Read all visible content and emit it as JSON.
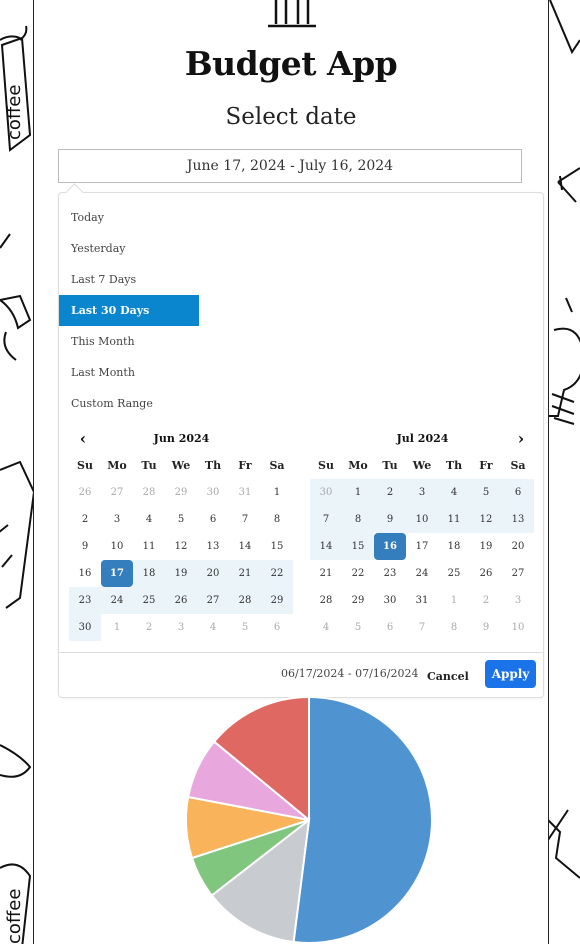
{
  "app": {
    "title": "Budget App",
    "subtitle": "Select date"
  },
  "date_input": {
    "value": "June 17, 2024 - July 16, 2024"
  },
  "ranges": [
    {
      "label": "Today",
      "active": false
    },
    {
      "label": "Yesterday",
      "active": false
    },
    {
      "label": "Last 7 Days",
      "active": false
    },
    {
      "label": "Last 30 Days",
      "active": true
    },
    {
      "label": "This Month",
      "active": false
    },
    {
      "label": "Last Month",
      "active": false
    },
    {
      "label": "Custom Range",
      "active": false
    }
  ],
  "weekdays": [
    "Su",
    "Mo",
    "Tu",
    "We",
    "Th",
    "Fr",
    "Sa"
  ],
  "calendars": [
    {
      "month": "Jun 2024",
      "days": [
        [
          "26",
          "off"
        ],
        [
          "27",
          "off"
        ],
        [
          "28",
          "off"
        ],
        [
          "29",
          "off"
        ],
        [
          "30",
          "off"
        ],
        [
          "31",
          "off"
        ],
        [
          "1",
          ""
        ],
        [
          "2",
          ""
        ],
        [
          "3",
          ""
        ],
        [
          "4",
          ""
        ],
        [
          "5",
          ""
        ],
        [
          "6",
          ""
        ],
        [
          "7",
          ""
        ],
        [
          "8",
          ""
        ],
        [
          "9",
          ""
        ],
        [
          "10",
          ""
        ],
        [
          "11",
          ""
        ],
        [
          "12",
          ""
        ],
        [
          "13",
          ""
        ],
        [
          "14",
          ""
        ],
        [
          "15",
          ""
        ],
        [
          "16",
          ""
        ],
        [
          "17",
          "sel"
        ],
        [
          "18",
          "in"
        ],
        [
          "19",
          "in"
        ],
        [
          "20",
          "in"
        ],
        [
          "21",
          "in"
        ],
        [
          "22",
          "in"
        ],
        [
          "23",
          "in"
        ],
        [
          "24",
          "in"
        ],
        [
          "25",
          "in"
        ],
        [
          "26",
          "in"
        ],
        [
          "27",
          "in"
        ],
        [
          "28",
          "in"
        ],
        [
          "29",
          "in"
        ],
        [
          "30",
          "in"
        ],
        [
          "1",
          "off"
        ],
        [
          "2",
          "off"
        ],
        [
          "3",
          "off"
        ],
        [
          "4",
          "off"
        ],
        [
          "5",
          "off"
        ],
        [
          "6",
          "off"
        ]
      ]
    },
    {
      "month": "Jul 2024",
      "days": [
        [
          "30",
          "off-in"
        ],
        [
          "1",
          "in"
        ],
        [
          "2",
          "in"
        ],
        [
          "3",
          "in"
        ],
        [
          "4",
          "in"
        ],
        [
          "5",
          "in"
        ],
        [
          "6",
          "in"
        ],
        [
          "7",
          "in"
        ],
        [
          "8",
          "in"
        ],
        [
          "9",
          "in"
        ],
        [
          "10",
          "in"
        ],
        [
          "11",
          "in"
        ],
        [
          "12",
          "in"
        ],
        [
          "13",
          "in"
        ],
        [
          "14",
          "in"
        ],
        [
          "15",
          "in"
        ],
        [
          "16",
          "sel"
        ],
        [
          "17",
          ""
        ],
        [
          "18",
          ""
        ],
        [
          "19",
          ""
        ],
        [
          "20",
          ""
        ],
        [
          "21",
          ""
        ],
        [
          "22",
          ""
        ],
        [
          "23",
          ""
        ],
        [
          "24",
          ""
        ],
        [
          "25",
          ""
        ],
        [
          "26",
          ""
        ],
        [
          "27",
          ""
        ],
        [
          "28",
          ""
        ],
        [
          "29",
          ""
        ],
        [
          "30",
          ""
        ],
        [
          "31",
          ""
        ],
        [
          "1",
          "off"
        ],
        [
          "2",
          "off"
        ],
        [
          "3",
          "off"
        ],
        [
          "4",
          "off"
        ],
        [
          "5",
          "off"
        ],
        [
          "6",
          "off"
        ],
        [
          "7",
          "off"
        ],
        [
          "8",
          "off"
        ],
        [
          "9",
          "off"
        ],
        [
          "10",
          "off"
        ]
      ]
    }
  ],
  "nav": {
    "prev_icon": "‹",
    "next_icon": "›"
  },
  "footer": {
    "selected_range": "06/17/2024 - 07/16/2024",
    "cancel_label": "Cancel",
    "apply_label": "Apply"
  },
  "colors": {
    "accent": "#0a86cf",
    "apply": "#1a73e8",
    "selected_day": "#357ebd",
    "in_range": "#ebf4f8"
  },
  "chart_data": {
    "type": "pie",
    "series": [
      {
        "values": [
          52,
          12.5,
          5.5,
          8,
          8,
          14
        ]
      }
    ],
    "colors": [
      "#4f93d1",
      "#c8ccd0",
      "#80c67f",
      "#f9b35a",
      "#e8a8dd",
      "#df6962"
    ]
  }
}
